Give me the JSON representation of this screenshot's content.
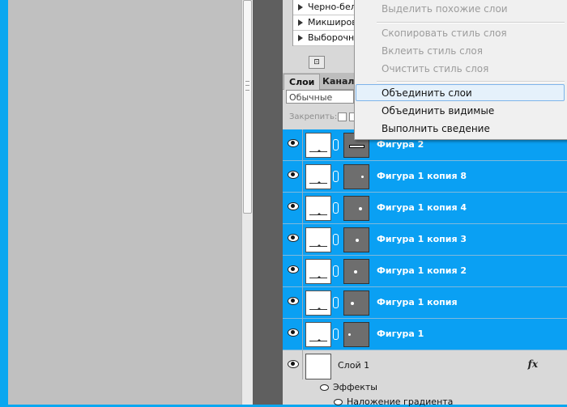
{
  "adjustments": {
    "items": [
      {
        "label": "Черно-белое"
      },
      {
        "label": "Микширование"
      },
      {
        "label": "Выборочная"
      }
    ]
  },
  "panel": {
    "tabs": [
      {
        "label": "Слои"
      },
      {
        "label": "Каналы"
      }
    ],
    "blend_mode": "Обычные",
    "lock_label": "Закрепить:"
  },
  "layers": [
    {
      "name": "Фигура 2",
      "selected": true,
      "mask_shape": "bar"
    },
    {
      "name": "Фигура 1 копия 8",
      "selected": true,
      "mask_shape": "dot"
    },
    {
      "name": "Фигура 1 копия 4",
      "selected": true,
      "mask_shape": "dot"
    },
    {
      "name": "Фигура 1 копия 3",
      "selected": true,
      "mask_shape": "dot"
    },
    {
      "name": "Фигура 1 копия 2",
      "selected": true,
      "mask_shape": "dot"
    },
    {
      "name": "Фигура 1 копия",
      "selected": true,
      "mask_shape": "dot"
    },
    {
      "name": "Фигура 1",
      "selected": true,
      "mask_shape": "dot"
    },
    {
      "name": "Слой 1",
      "selected": false,
      "fx": "fx"
    }
  ],
  "effects": {
    "label": "Эффекты",
    "items": [
      {
        "label": "Наложение градиента"
      }
    ]
  },
  "context_menu": {
    "items": [
      {
        "label": "Выделить похожие слои",
        "enabled": false
      },
      {
        "label": "Скопировать стиль слоя",
        "enabled": false
      },
      {
        "label": "Вклеить стиль слоя",
        "enabled": false
      },
      {
        "label": "Очистить стиль слоя",
        "enabled": false
      },
      {
        "label": "Объединить слои",
        "enabled": true,
        "hovered": true
      },
      {
        "label": "Объединить видимые",
        "enabled": true
      },
      {
        "label": "Выполнить сведение",
        "enabled": true
      }
    ]
  },
  "colors": {
    "selection": "#0aa0f3",
    "canvas": "#c0c0c0",
    "menu_hover": "#e5f1fb"
  }
}
